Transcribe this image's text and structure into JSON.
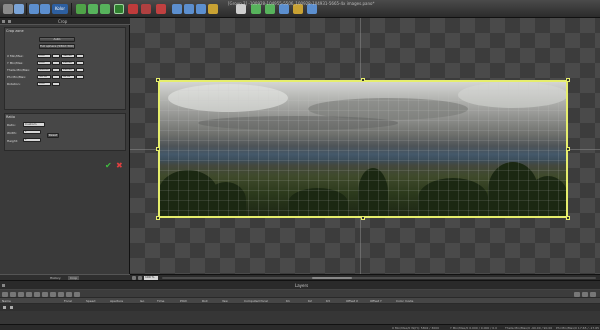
{
  "window": {
    "title": "[Group 2] -100928-104955-5506_100928-104931-5665-4x images.pano*"
  },
  "toolbar": {
    "icons": [
      "new-icon",
      "open-icon",
      "save-icon",
      "undo-icon",
      "redo-icon",
      "kolor-icon",
      "project-icon",
      "crop-icon",
      "horizon-icon",
      "straighten-icon",
      "select-icon",
      "move-icon",
      "levels-icon",
      "color-icon",
      "settings-icon",
      "render-icon",
      "grid-icon",
      "preview-icon"
    ],
    "kolor_label": "Kolor"
  },
  "crop_panel": {
    "header": "Crop",
    "zone_title": "Crop zone",
    "auto_button": "Auto",
    "full_sphere_button": "Full sphere (5802:300)",
    "fields": [
      {
        "label": "X Min/Max:",
        "min": "0.00",
        "max": "360.00"
      },
      {
        "label": "Y Min/Max:",
        "min": "0.00",
        "max": "180.00"
      },
      {
        "label": "Theta Min/Max:",
        "min": "-180.00",
        "max": "180.00"
      },
      {
        "label": "Phi Min/Max:",
        "min": "-90.00",
        "max": "90.00"
      },
      {
        "label": "Rotation:",
        "min": "0.00",
        "max": ""
      }
    ],
    "ratio_title": "Ratio",
    "ratio_label": "Ratio:",
    "ratio_value": "Custom",
    "width_label": "Width:",
    "width_value": "1",
    "height_label": "Height:",
    "height_value": "1",
    "reset_button": "Reset",
    "tabs": [
      "History",
      "Crop"
    ]
  },
  "canvas": {
    "zoom": "100 %"
  },
  "layers": {
    "title": "Layers",
    "columns": [
      "Name",
      "Focal",
      "Speed",
      "Aperture",
      "Iso",
      "Time",
      "Pitch",
      "Roll",
      "Yaw",
      "Computed focal",
      "K1",
      "K2",
      "K3",
      "Offset X",
      "Offset Y",
      "Color mode"
    ]
  },
  "status": {
    "left": "0 Min/Max/0 W(H): 5802 / 3000",
    "mid1": "Y Min/Max/0 0.000 / 0.000 / 0.0",
    "mid2": "Theta Min/Max/0 -90.00 / 90.00",
    "right": "Phi Min/Max/0 17.65 / -17.65"
  }
}
